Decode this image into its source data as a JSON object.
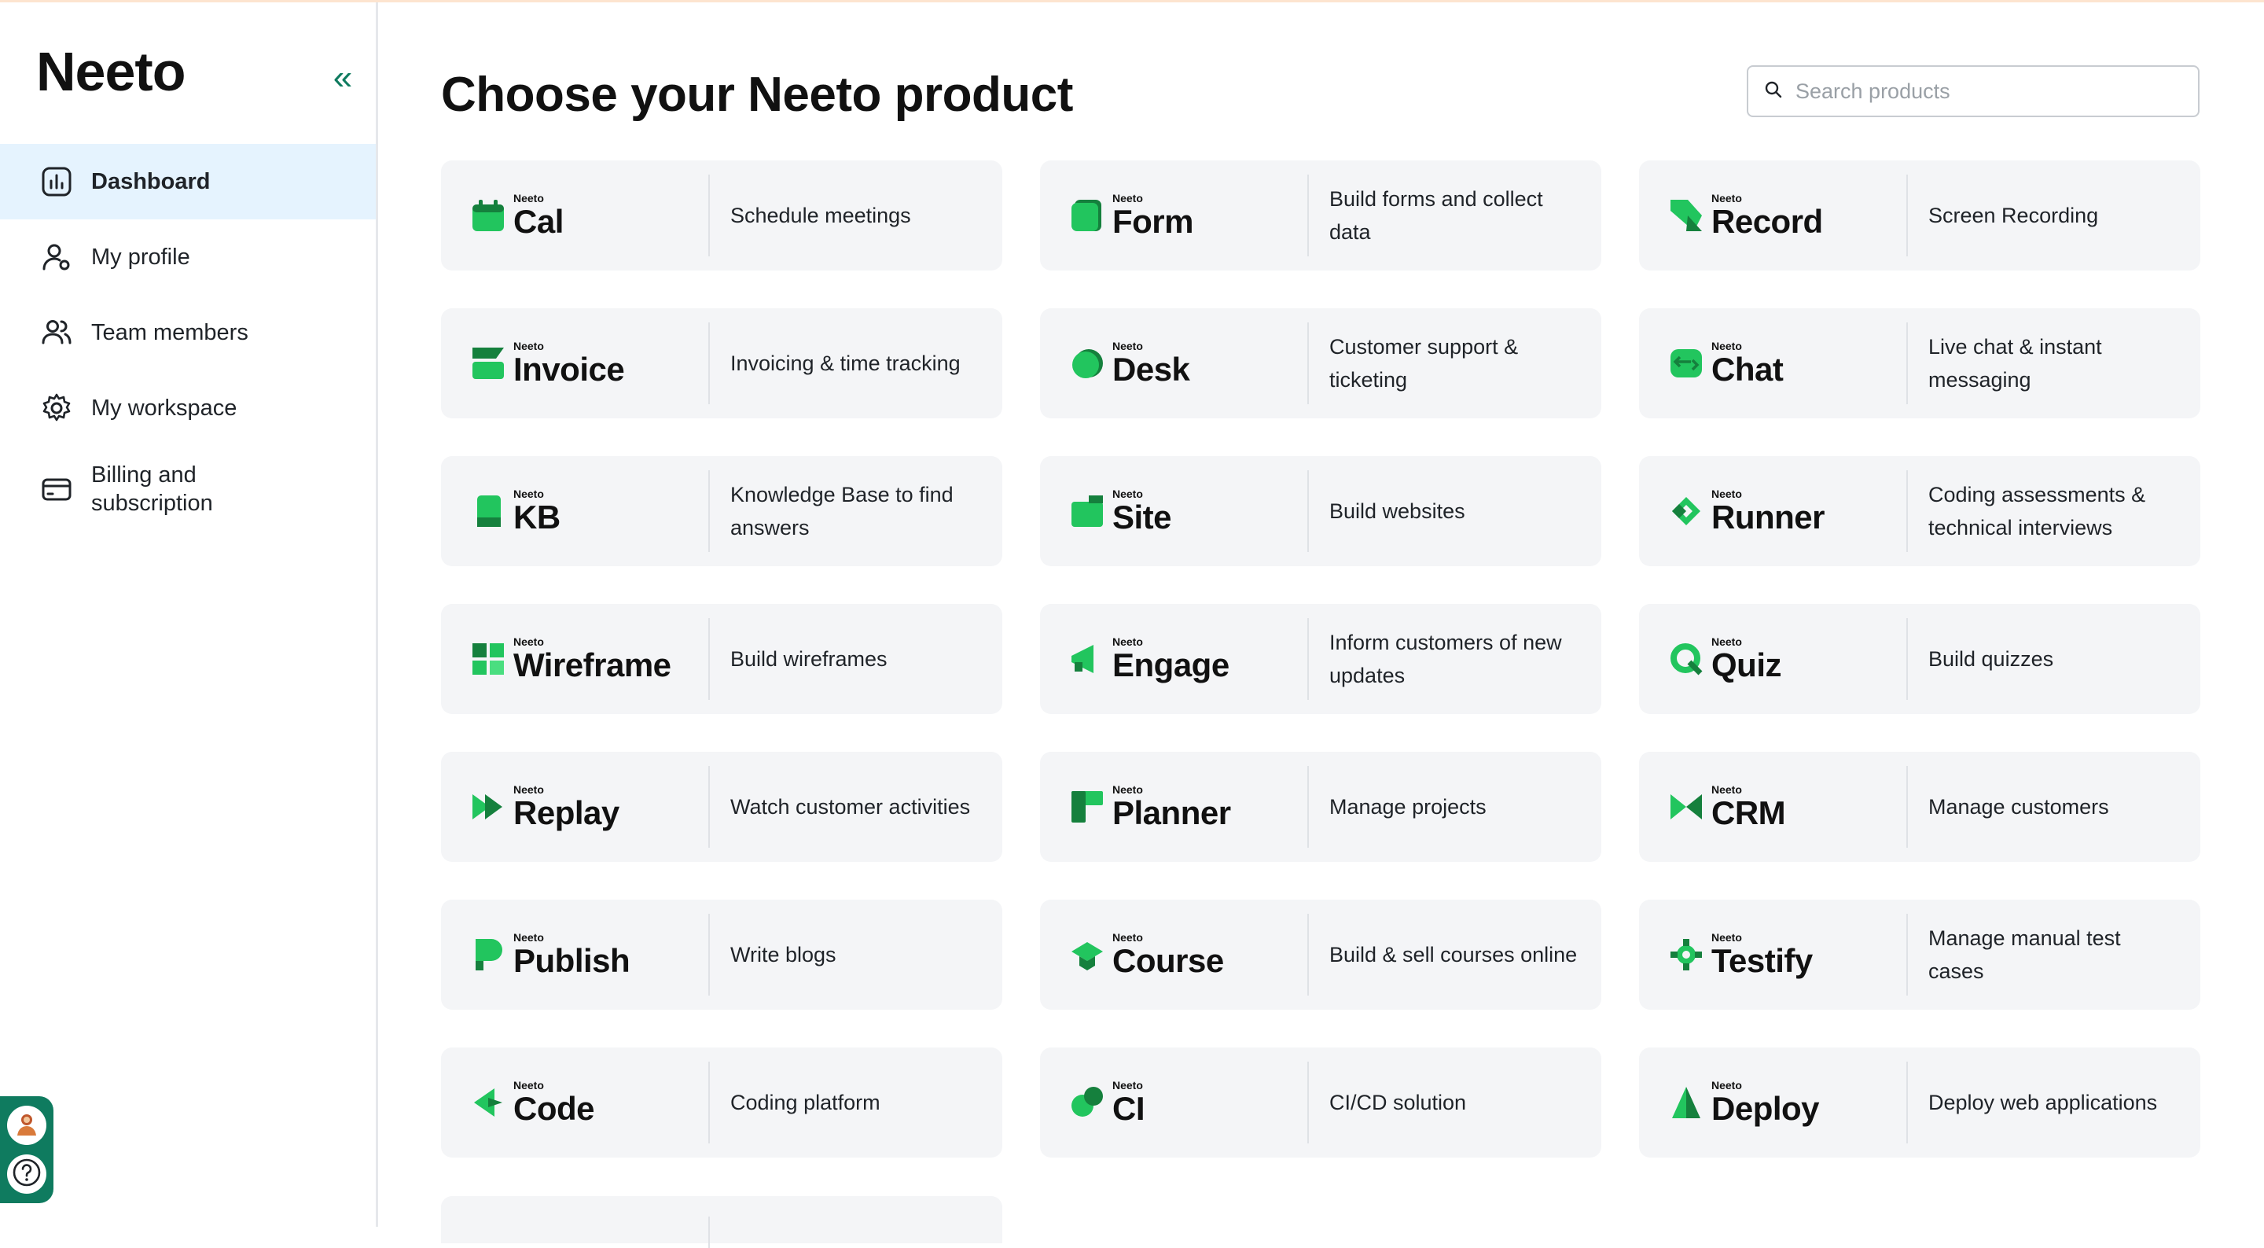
{
  "app": {
    "brand": "Neeto",
    "accent_color": "#0f7b5f",
    "logo_green": "#22c55e"
  },
  "sidebar": {
    "collapse_icon": "chevrons-left-icon",
    "items": [
      {
        "label": "Dashboard",
        "icon": "chart-bar-icon",
        "active": true
      },
      {
        "label": "My profile",
        "icon": "user-settings-icon",
        "active": false
      },
      {
        "label": "Team members",
        "icon": "users-icon",
        "active": false
      },
      {
        "label": "My workspace",
        "icon": "gear-icon",
        "active": false
      },
      {
        "label": "Billing and subscription",
        "icon": "credit-card-icon",
        "active": false
      }
    ],
    "helper_buttons": [
      {
        "icon": "avatar-icon"
      },
      {
        "icon": "help-icon"
      }
    ]
  },
  "main": {
    "title": "Choose your Neeto product",
    "search": {
      "placeholder": "Search products",
      "value": ""
    },
    "products": [
      {
        "small": "Neeto",
        "name": "Cal",
        "description": "Schedule meetings"
      },
      {
        "small": "Neeto",
        "name": "Form",
        "description": "Build forms and collect data"
      },
      {
        "small": "Neeto",
        "name": "Record",
        "description": "Screen Recording"
      },
      {
        "small": "Neeto",
        "name": "Invoice",
        "description": "Invoicing & time tracking"
      },
      {
        "small": "Neeto",
        "name": "Desk",
        "description": "Customer support & ticketing"
      },
      {
        "small": "Neeto",
        "name": "Chat",
        "description": "Live chat & instant messaging"
      },
      {
        "small": "Neeto",
        "name": "KB",
        "description": "Knowledge Base to find answers"
      },
      {
        "small": "Neeto",
        "name": "Site",
        "description": "Build websites"
      },
      {
        "small": "Neeto",
        "name": "Runner",
        "description": "Coding assessments & technical interviews"
      },
      {
        "small": "Neeto",
        "name": "Wireframe",
        "description": "Build wireframes"
      },
      {
        "small": "Neeto",
        "name": "Engage",
        "description": "Inform customers of new updates"
      },
      {
        "small": "Neeto",
        "name": "Quiz",
        "description": "Build quizzes"
      },
      {
        "small": "Neeto",
        "name": "Replay",
        "description": "Watch customer activities"
      },
      {
        "small": "Neeto",
        "name": "Planner",
        "description": "Manage projects"
      },
      {
        "small": "Neeto",
        "name": "CRM",
        "description": "Manage customers"
      },
      {
        "small": "Neeto",
        "name": "Publish",
        "description": "Write blogs"
      },
      {
        "small": "Neeto",
        "name": "Course",
        "description": "Build & sell courses online"
      },
      {
        "small": "Neeto",
        "name": "Testify",
        "description": "Manage manual test cases"
      },
      {
        "small": "Neeto",
        "name": "Code",
        "description": "Coding platform"
      },
      {
        "small": "Neeto",
        "name": "CI",
        "description": "CI/CD solution"
      },
      {
        "small": "Neeto",
        "name": "Deploy",
        "description": "Deploy web applications"
      }
    ]
  }
}
